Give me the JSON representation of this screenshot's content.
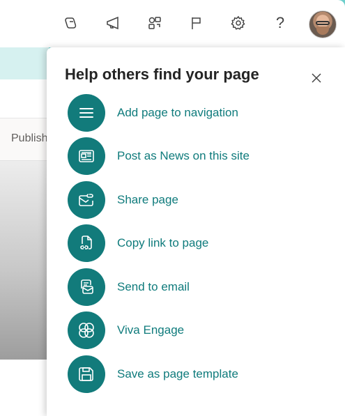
{
  "topbar": {
    "icons": [
      "copilot-icon",
      "megaphone-icon",
      "shapes-icon",
      "flag-icon",
      "settings-icon",
      "help-icon"
    ],
    "help_glyph": "?"
  },
  "background": {
    "publish_label": "Publish"
  },
  "panel": {
    "title": "Help others find your page",
    "accent_color": "#127b7b",
    "items": [
      {
        "label": "Add page to navigation",
        "icon": "menu-icon"
      },
      {
        "label": "Post as News on this site",
        "icon": "news-icon"
      },
      {
        "label": "Share page",
        "icon": "share-mail-icon"
      },
      {
        "label": "Copy link to page",
        "icon": "copy-link-icon"
      },
      {
        "label": "Send to email",
        "icon": "email-icon"
      },
      {
        "label": "Viva Engage",
        "icon": "viva-engage-icon"
      },
      {
        "label": "Save as page template",
        "icon": "save-icon"
      }
    ]
  }
}
